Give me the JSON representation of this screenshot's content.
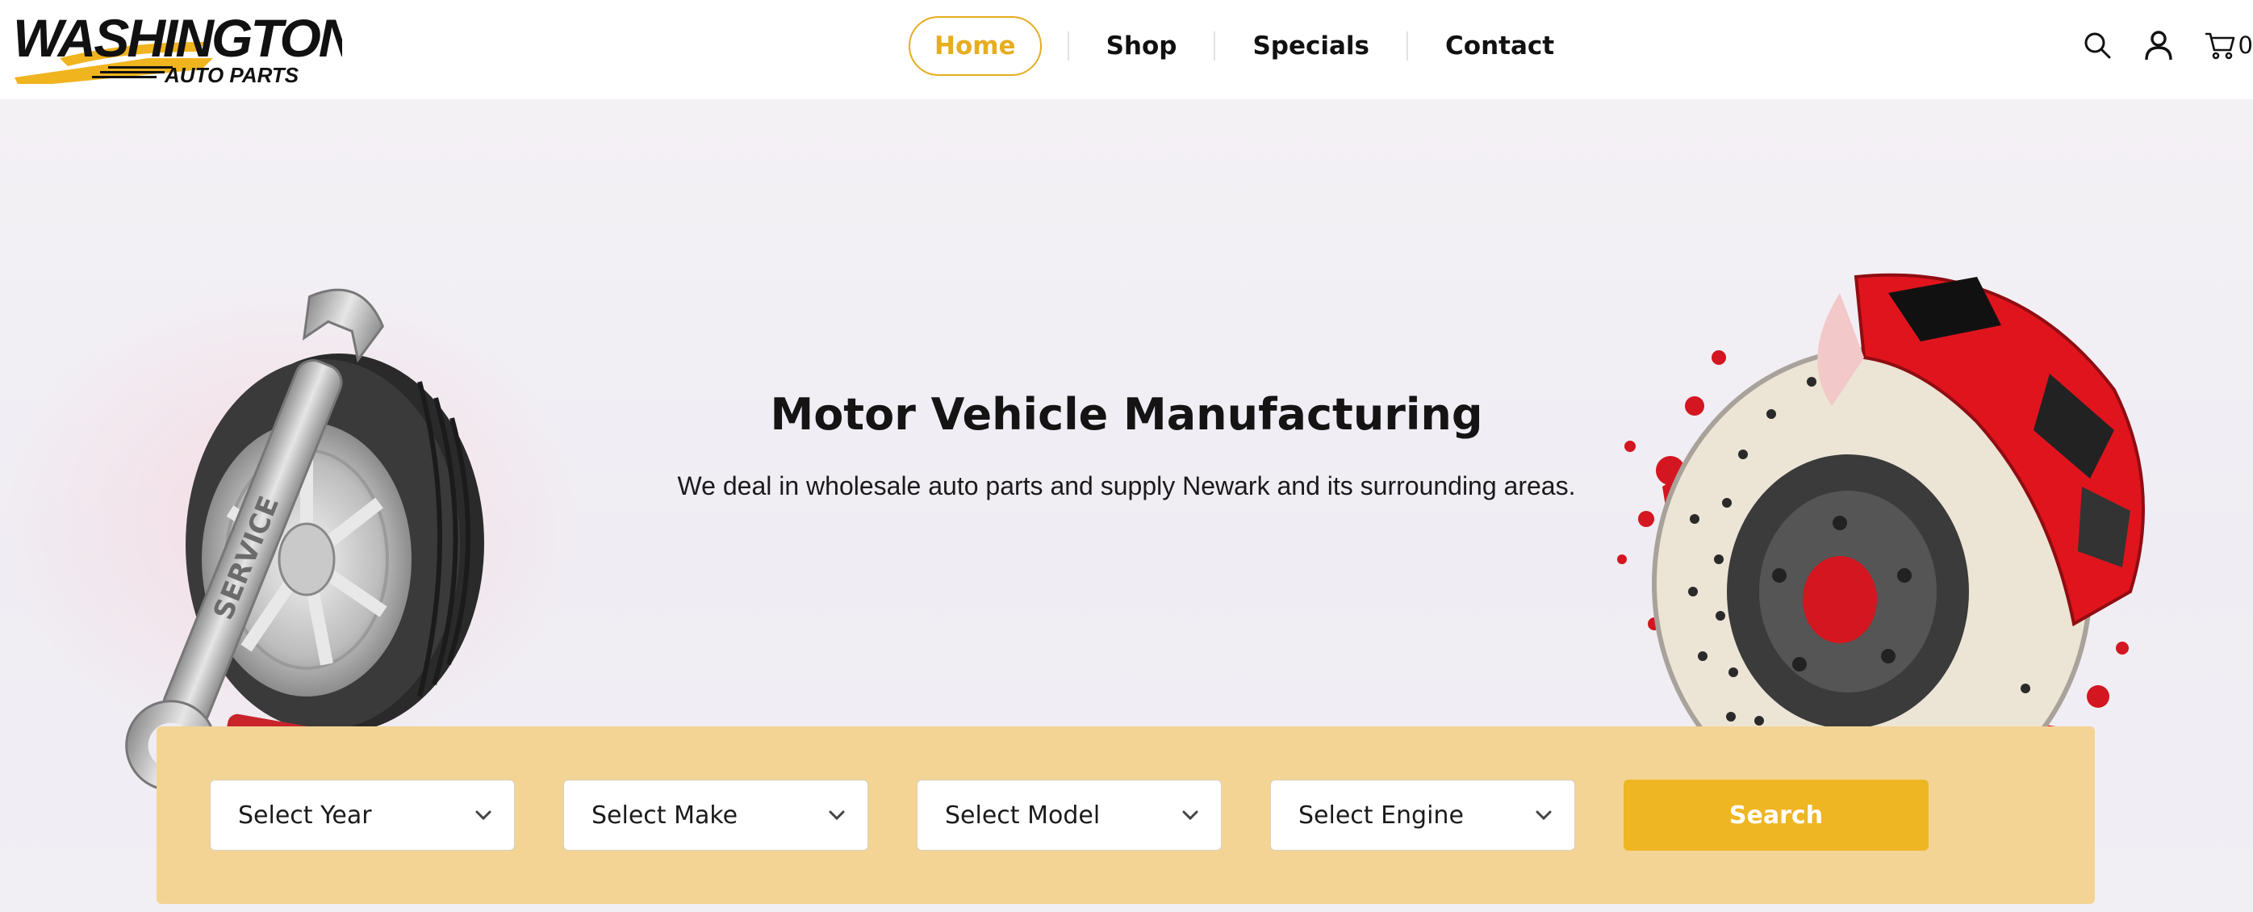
{
  "brand": {
    "logo_top": "WASHINGTON",
    "logo_bottom": "AUTO PARTS",
    "logo_mark": "™",
    "accent_color": "#f0b41f"
  },
  "nav": {
    "items": [
      {
        "label": "Home",
        "active": true
      },
      {
        "label": "Shop",
        "active": false
      },
      {
        "label": "Specials",
        "active": false
      },
      {
        "label": "Contact",
        "active": false
      }
    ]
  },
  "header_icons": {
    "search": "search-icon",
    "account": "user-icon",
    "cart": "cart-icon",
    "cart_count": "0"
  },
  "hero": {
    "title": "Motor Vehicle Manufacturing",
    "subtitle": "We deal in wholesale auto parts and supply Newark and its surrounding areas.",
    "wrench_text": "SERVICE"
  },
  "search": {
    "year_placeholder": "Select Year",
    "make_placeholder": "Select Make",
    "model_placeholder": "Select Model",
    "engine_placeholder": "Select Engine",
    "button_label": "Search",
    "button_color": "#efb624",
    "panel_color": "#f3d495"
  }
}
